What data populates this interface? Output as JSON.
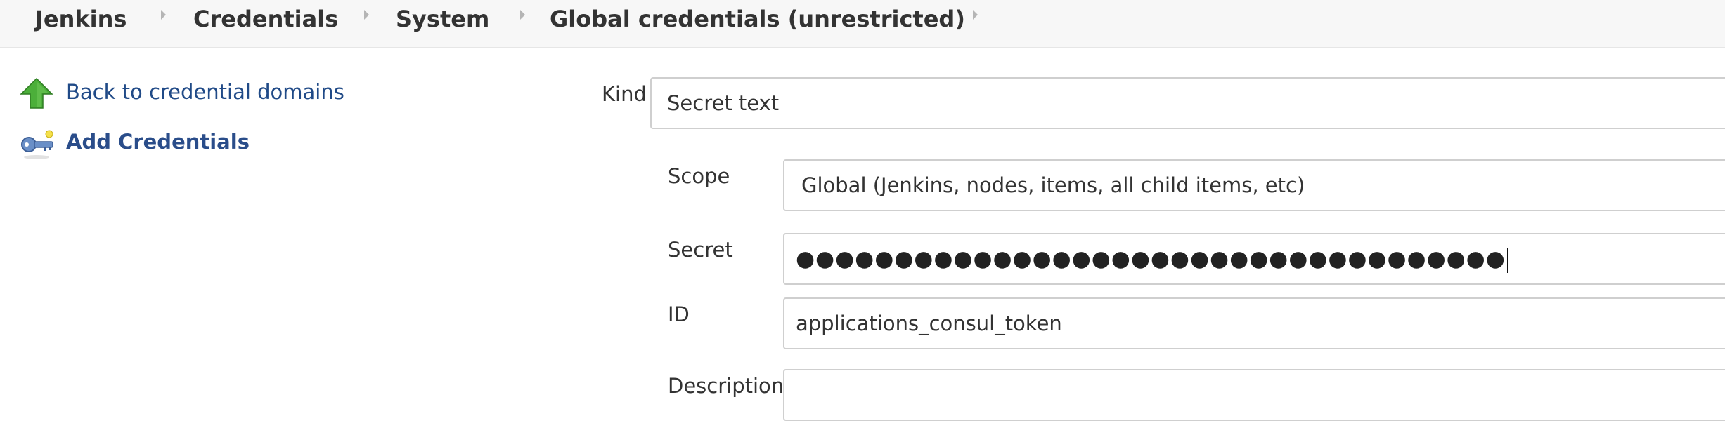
{
  "breadcrumb": {
    "items": [
      "Jenkins",
      "Credentials",
      "System",
      "Global credentials (unrestricted)"
    ]
  },
  "sidebar": {
    "back_label": "Back to credential domains",
    "add_label": "Add Credentials",
    "back_icon": "arrow-up-icon",
    "add_icon": "key-icon"
  },
  "form": {
    "kind": {
      "label": "Kind",
      "value": "Secret text"
    },
    "scope": {
      "label": "Scope",
      "value": "Global (Jenkins, nodes, items, all child items, etc)"
    },
    "secret": {
      "label": "Secret",
      "value": "●●●●●●●●●●●●●●●●●●●●●●●●●●●●●●●●●●●●"
    },
    "id": {
      "label": "ID",
      "value": "applications_consul_token"
    },
    "description": {
      "label": "Description",
      "value": ""
    }
  },
  "colors": {
    "breadcrumb_bg": "#f7f7f7",
    "link": "#204a87",
    "arrow_green": "#4caf3a"
  }
}
